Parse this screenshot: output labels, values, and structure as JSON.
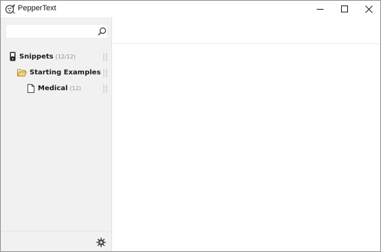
{
  "window": {
    "title": "PepperText",
    "app_icon": "pepper-logo-icon",
    "controls": [
      "minimize-icon",
      "maximize-icon",
      "close-icon"
    ]
  },
  "sidebar": {
    "search": {
      "value": "",
      "placeholder": "",
      "icon": "search-icon"
    },
    "tree": [
      {
        "label": "Snippets",
        "count": "(12/12)",
        "icon": "device-icon"
      },
      {
        "label": "Starting Examples",
        "count": "",
        "icon": "folder-open-icon"
      },
      {
        "label": "Medical",
        "count": "(12)",
        "icon": "document-icon"
      }
    ],
    "footer": {
      "icon": "gear-icon"
    }
  },
  "colors": {
    "sidebar_bg": "#f1f1f1",
    "folder_icon": "#d9a62b",
    "muted_text": "#8c8c8c"
  }
}
